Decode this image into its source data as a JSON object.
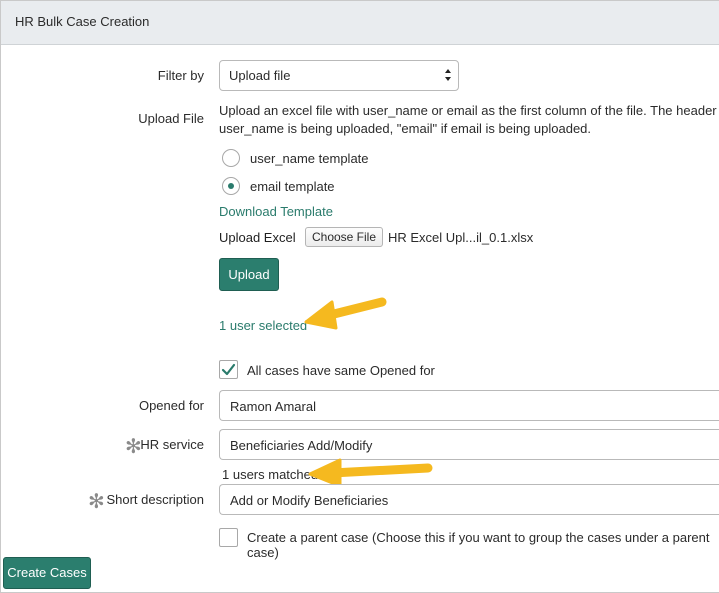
{
  "header": {
    "title": "HR Bulk Case Creation"
  },
  "filter": {
    "label": "Filter by",
    "value": "Upload file",
    "caret_icon": "up-down-caret-icon"
  },
  "upload_file": {
    "label": "Upload File",
    "description_line1": "Upload an excel file with user_name or email as the first column of the file. The header of the",
    "description_line2": "user_name is being uploaded, \"email\" if email is being uploaded.",
    "options": [
      {
        "label": "user_name template",
        "selected": false
      },
      {
        "label": "email template",
        "selected": true
      }
    ],
    "download_link": "Download Template",
    "upload_excel_label": "Upload Excel",
    "choose_file_label": "Choose File",
    "file_name": "HR Excel Upl...il_0.1.xlsx",
    "upload_button": "Upload",
    "selected_status": "1 user selected"
  },
  "same_opened_for": {
    "label": "All cases have same Opened for",
    "checked": true
  },
  "opened_for": {
    "label": "Opened for",
    "value": "Ramon Amaral"
  },
  "hr_service": {
    "label": "HR service",
    "value": "Beneficiaries Add/Modify",
    "matched": "1 users matched"
  },
  "short_description": {
    "label": "Short description",
    "value": "Add or Modify Beneficiaries"
  },
  "parent_case": {
    "label": "Create a parent case (Choose this if you want to group the cases under a parent case)",
    "checked": false
  },
  "footer": {
    "create_button": "Create Cases"
  },
  "colors": {
    "accent": "#2b7e6e",
    "annotation_arrow": "#f5b91f"
  }
}
